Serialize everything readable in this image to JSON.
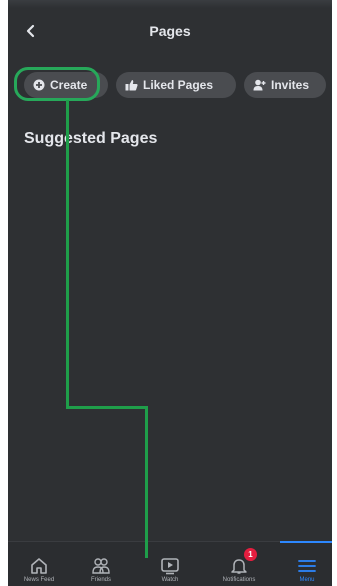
{
  "header": {
    "title": "Pages"
  },
  "chips": [
    {
      "label": "Create",
      "icon": "plus-circle-icon"
    },
    {
      "label": "Liked Pages",
      "icon": "thumbs-up-icon"
    },
    {
      "label": "Invites",
      "icon": "person-add-icon"
    }
  ],
  "section": {
    "title": "Suggested Pages"
  },
  "tabbar": {
    "items": [
      {
        "label": "News Feed",
        "icon": "home-icon"
      },
      {
        "label": "Friends",
        "icon": "friends-icon"
      },
      {
        "label": "Watch",
        "icon": "watch-icon"
      },
      {
        "label": "Notifications",
        "icon": "bell-icon",
        "badge": "1"
      },
      {
        "label": "Menu",
        "icon": "menu-icon",
        "active": true
      }
    ]
  },
  "colors": {
    "background": "#2e3033",
    "chip": "#4a4c50",
    "text": "#e4e6eb",
    "accent": "#2d88ff",
    "highlight": "#27a85a",
    "badge": "#e41e3f"
  }
}
